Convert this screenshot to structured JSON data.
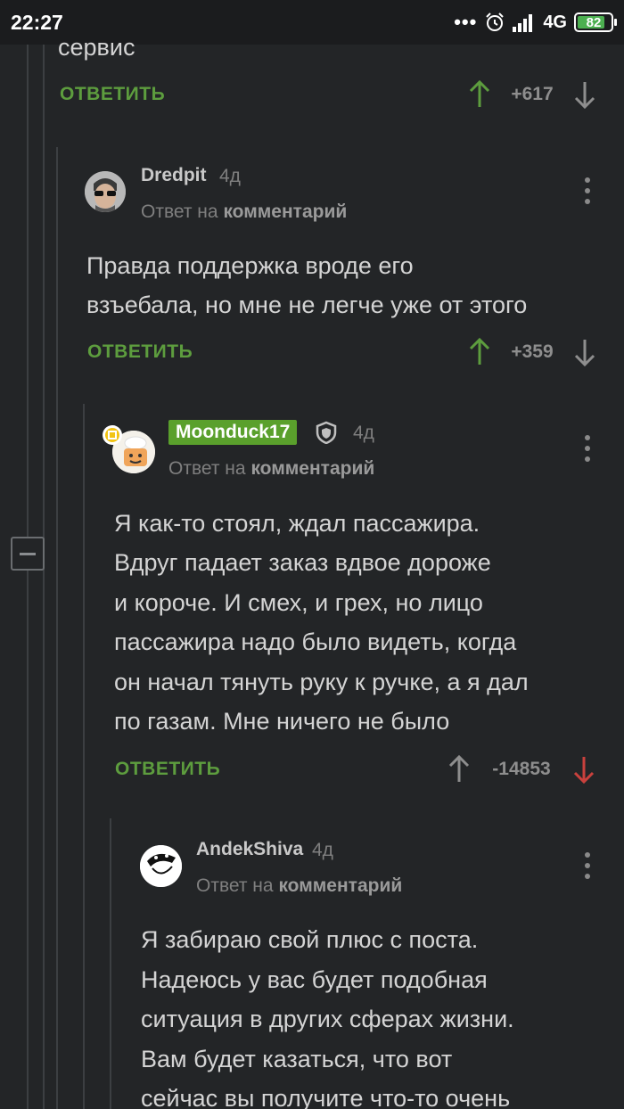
{
  "status_bar": {
    "time": "22:27",
    "dots": "•••",
    "network": "4G",
    "battery": "82",
    "battery_level": 0.82
  },
  "top_comment": {
    "text_tail": "сервис",
    "reply_label": "ОТВЕТИТЬ",
    "rating": "+617"
  },
  "comments": [
    {
      "username": "Dredpit",
      "age": "4д",
      "reply_prefix": "Ответ на",
      "reply_target": "комментарий",
      "lines": [
        "Правда поддержка вроде его",
        "взъебала, но мне не легче уже от этого"
      ],
      "reply_label": "ОТВЕТИТЬ",
      "rating": "+359"
    },
    {
      "username": "Moonduck17",
      "age": "4д",
      "reply_prefix": "Ответ на",
      "reply_target": "комментарий",
      "lines": [
        "Я как-то стоял, ждал пассажира.",
        "Вдруг падает заказ вдвое дороже",
        "и короче. И смех, и грех, но лицо",
        "пассажира надо было видеть, когда",
        "он начал тянуть руку к ручке, а я дал",
        "по газам. Мне ничего не было"
      ],
      "reply_label": "ОТВЕТИТЬ",
      "rating": "-14853"
    },
    {
      "username": "AndekShiva",
      "age": "4д",
      "reply_prefix": "Ответ на",
      "reply_target": "комментарий",
      "lines": [
        "Я забираю свой плюс с поста.",
        "Надеюсь у вас будет подобная",
        "ситуация в других сферах жизни.",
        "Вам будет казаться, что вот",
        "сейчас вы получите что-то очень"
      ]
    }
  ],
  "colors": {
    "background": "#232527",
    "accent": "#5d9d3e",
    "upvote": "#5d9d3e",
    "downvote": "#c9413d",
    "neutral": "#8e8e8e"
  }
}
